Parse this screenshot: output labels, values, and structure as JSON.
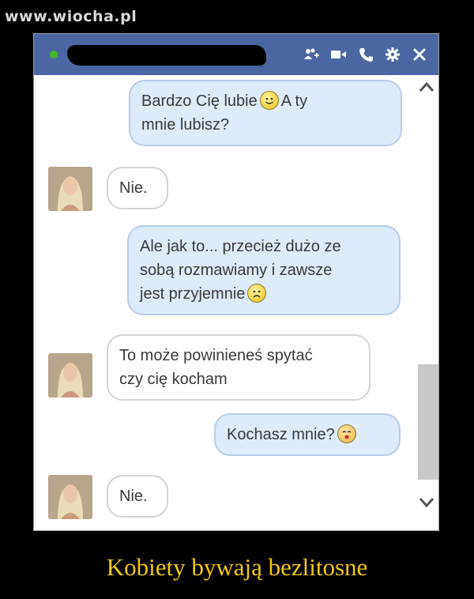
{
  "watermark": "www.wiocha.pl",
  "titlebar": {
    "icons": [
      "add-friend-icon",
      "video-call-icon",
      "phone-icon",
      "gear-icon",
      "close-icon"
    ]
  },
  "messages": [
    {
      "from": "me",
      "line1": "Bardzo Cię lubie",
      "line1_after": "A ty",
      "line2": "mnie lubisz?",
      "emoji": "smile"
    },
    {
      "from": "them",
      "text": "Nie."
    },
    {
      "from": "me",
      "line1": "Ale jak to... przecież dużo ze",
      "line2": "sobą rozmawiamy i zawsze",
      "line3": "jest przyjemnie",
      "emoji": "sad"
    },
    {
      "from": "them",
      "line1": "To może powinieneś spytać",
      "line2": "czy cię kocham"
    },
    {
      "from": "me",
      "text": "Kochasz mnie?",
      "emoji": "kiss"
    },
    {
      "from": "them",
      "text": "Nie."
    }
  ],
  "caption": "Kobiety bywają bezlitosne",
  "colors": {
    "titlebar": "#4c66a4",
    "online": "#42b72a",
    "my_bubble": "#ddebfa",
    "caption": "#f2c811"
  }
}
